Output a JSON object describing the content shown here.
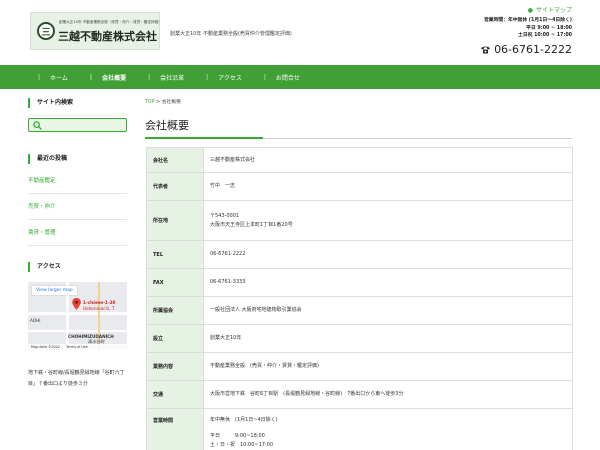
{
  "header": {
    "logo_sub": "創業大正10年 不動産業務全般（売買・仲介・賃貸・鑑定評価）",
    "logo_name": "三越不動産株式会社",
    "tagline": "創業大正10年 不動産業務全般(売買仲介管理鑑定評価)",
    "sitemap": "サイトマップ",
    "hours_line1": "営業時間：年中無休 (1月1日～4日除く)",
    "hours_line2": "平日 9:00 ~ 18:00",
    "hours_line3": "土日祝 10:00 ~ 17:00",
    "phone": "06-6761-2222"
  },
  "nav": {
    "items": [
      {
        "label": "ホーム"
      },
      {
        "label": "会社概要"
      },
      {
        "label": "会社沿革"
      },
      {
        "label": "アクセス"
      },
      {
        "label": "お問合せ"
      }
    ]
  },
  "sidebar": {
    "search_heading": "サイト内検索",
    "posts_heading": "最近の投稿",
    "posts": [
      "不動産鑑定",
      "売買・仲介",
      "賃貸・管理"
    ],
    "access_heading": "アクセス",
    "map": {
      "button": "View larger map",
      "label_address": "1-chōme-1-20",
      "label_address2": "Uehonmachi, T",
      "label_left": "AOHI",
      "label_bottom": "CHOHIMIZUDANICH",
      "label_bottom2": "清水谷町",
      "footer_data": "Map data ©2022",
      "footer_terms": "Terms of Use"
    },
    "access_text": "地下鉄・谷町線/長堀鶴見緑地線「谷町六丁目」７番出口より徒歩３分"
  },
  "main": {
    "crumb_home": "TOP",
    "crumb_sep": ">",
    "crumb_current": "会社概要",
    "title": "会社概要",
    "rows": [
      {
        "key": "会社名",
        "lines": [
          "三越不動産株式会社"
        ]
      },
      {
        "key": "代表者",
        "lines": [
          "竹中　一志"
        ]
      },
      {
        "key": "所在地",
        "lines": [
          "〒543-0001",
          "大阪市天王寺区上本町1丁目1番20号"
        ]
      },
      {
        "key": "TEL",
        "lines": [
          "06-6761-2222"
        ]
      },
      {
        "key": "FAX",
        "lines": [
          "06-6761-3333"
        ]
      },
      {
        "key": "所属協会",
        "lines": [
          "一般社団法人 大阪府宅地建物取引業協会"
        ]
      },
      {
        "key": "設立",
        "lines": [
          "創業大正10年"
        ]
      },
      {
        "key": "業務内容",
        "lines": [
          "不動産業務全般　(売買・仲介・賃貸・鑑定評価)"
        ]
      },
      {
        "key": "交通",
        "lines": [
          "大阪市営地下鉄　谷町6丁目駅　(長堀鶴見緑地線・谷町線)　7番出口から東へ徒歩3分"
        ]
      },
      {
        "key": "営業時間",
        "lines": [
          "年中無休　(1月1日~4日除く)",
          "",
          "平日　　　9:00~18:00",
          "土・日・祝　10:00~17:00"
        ]
      }
    ]
  },
  "colors": {
    "brand_green": "#40a035",
    "link_green": "#3aaa35",
    "key_cell_bg": "#e6f2e3"
  }
}
